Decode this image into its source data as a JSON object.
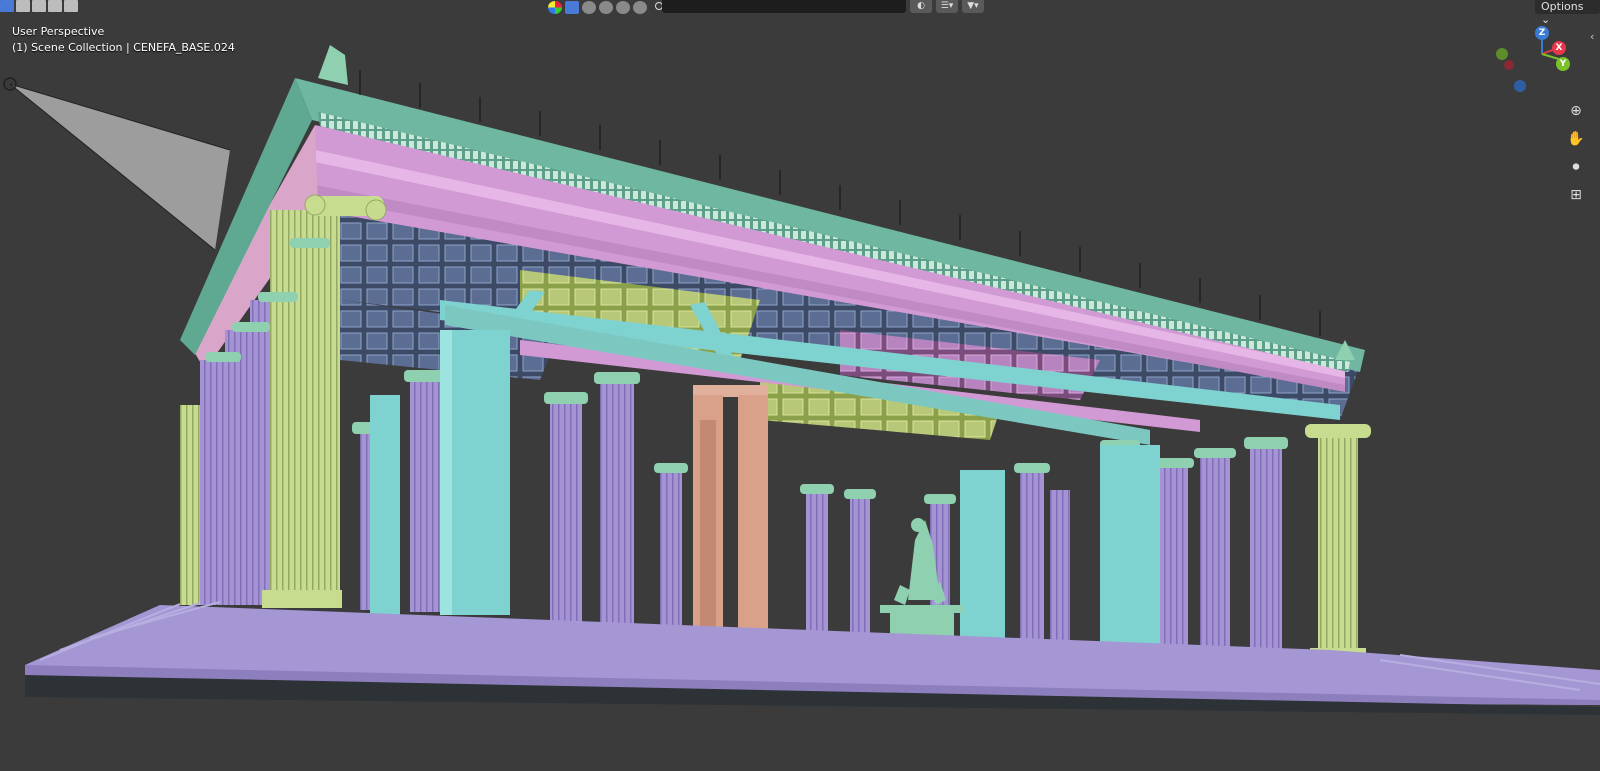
{
  "viewport": {
    "view_name": "User Perspective",
    "collection_info": "(1) Scene Collection | CENEFA_BASE.024"
  },
  "header": {
    "options_label": "Options"
  },
  "gizmo": {
    "x_label": "X",
    "y_label": "Y",
    "z_label": "Z"
  },
  "icons": {
    "zoom": "zoom-icon",
    "pan": "hand-icon",
    "camera": "camera-icon",
    "ortho": "grid-icon"
  },
  "colors": {
    "background": "#3b3b3b",
    "column_lilac": "#a593d6",
    "column_cyan": "#7ed2cf",
    "column_yellow": "#c8dc8f",
    "door_pink": "#d9a08a",
    "cornice_green": "#6fb7a0",
    "entablature_pink": "#d29ad4",
    "axis_x": "#e8364a",
    "axis_y": "#7bbf2a",
    "axis_z": "#3b7bd6"
  }
}
